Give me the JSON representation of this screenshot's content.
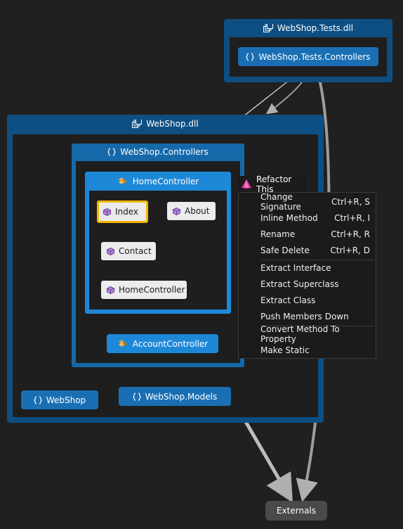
{
  "tests_assembly": {
    "title": "WebShop.Tests.dll",
    "namespace": "WebShop.Tests.Controllers"
  },
  "main_assembly": {
    "title": "WebShop.dll"
  },
  "controllers_namespace": {
    "title": "WebShop.Controllers"
  },
  "home_controller": {
    "title": "HomeController",
    "members": [
      "Index",
      "About",
      "Contact",
      "HomeController"
    ]
  },
  "account_controller": {
    "title": "AccountController"
  },
  "namespaces": {
    "webshop": "WebShop",
    "models": "WebShop.Models"
  },
  "externals": "Externals",
  "refactor_menu": {
    "header": "Refactor This",
    "items": [
      {
        "label": "Change Signature",
        "shortcut": "Ctrl+R, S"
      },
      {
        "label": "Inline Method",
        "shortcut": "Ctrl+R, I"
      },
      {
        "label": "Rename",
        "shortcut": "Ctrl+R, R"
      },
      {
        "label": "Safe Delete",
        "shortcut": "Ctrl+R, D"
      },
      {
        "label": "Extract Interface",
        "shortcut": ""
      },
      {
        "label": "Extract Superclass",
        "shortcut": ""
      },
      {
        "label": "Extract Class",
        "shortcut": ""
      },
      {
        "label": "Push Members Down",
        "shortcut": ""
      },
      {
        "label": "Convert Method To Property",
        "shortcut": ""
      },
      {
        "label": "Make Static",
        "shortcut": ""
      }
    ]
  },
  "colors": {
    "background": "#202020",
    "assembly": "#0e4f83",
    "namespace": "#1669a9",
    "class": "#1e88d8",
    "selection": "#f2b600",
    "member": "#ececec"
  },
  "icons": {
    "assembly": "assembly-icon",
    "namespace": "namespace-icon",
    "class": "class-icon",
    "method": "method-icon",
    "refactor": "refactor-icon"
  }
}
